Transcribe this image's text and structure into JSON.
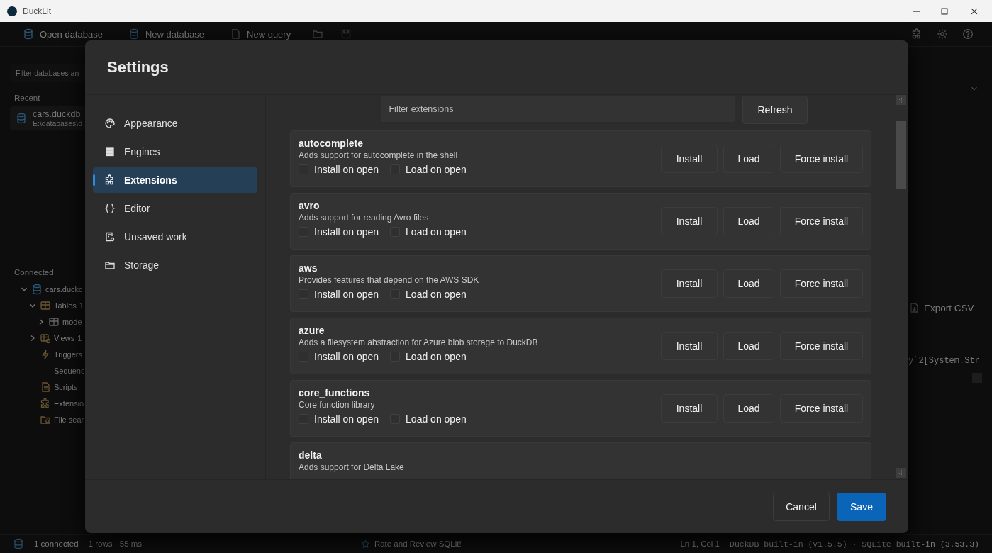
{
  "window": {
    "title": "DuckLit"
  },
  "toolbar": {
    "items": [
      "Open database",
      "New database",
      "New query"
    ]
  },
  "sidebar": {
    "filter_placeholder": "Filter databases an",
    "recent_label": "Recent",
    "recent": [
      {
        "name": "cars.duckdb",
        "path": "E:\\databases\\d"
      }
    ],
    "connected_label": "Connected",
    "tree": [
      {
        "label": "cars.duckc",
        "expanded": true,
        "children": [
          {
            "label": "Tables",
            "count": "1",
            "expanded": true,
            "children": [
              {
                "label": "mode",
                "expanded": false
              }
            ]
          },
          {
            "label": "Views",
            "count": "1",
            "expanded": false
          },
          {
            "label": "Triggers"
          },
          {
            "label": "Sequenc"
          },
          {
            "label": "Scripts"
          },
          {
            "label": "Extensio"
          },
          {
            "label": "File sear"
          }
        ]
      }
    ]
  },
  "results": {
    "export_label": "Export CSV",
    "cell_text": "y`2[System.Str"
  },
  "settings": {
    "title": "Settings",
    "nav": [
      {
        "label": "Appearance",
        "selected": false
      },
      {
        "label": "Engines",
        "selected": false
      },
      {
        "label": "Extensions",
        "selected": true
      },
      {
        "label": "Editor",
        "selected": false
      },
      {
        "label": "Unsaved work",
        "selected": false
      },
      {
        "label": "Storage",
        "selected": false
      }
    ],
    "filter_placeholder": "Filter extensions",
    "refresh_label": "Refresh",
    "extensions": [
      {
        "name": "autocomplete",
        "description": "Adds support for autocomplete in the shell",
        "options": [
          {
            "label": "Install on open",
            "checked": false
          },
          {
            "label": "Load on open",
            "checked": false
          }
        ],
        "buttons": [
          "Install",
          "Load",
          "Force install"
        ]
      },
      {
        "name": "avro",
        "description": "Adds support for reading Avro files",
        "options": [
          {
            "label": "Install on open",
            "checked": false
          },
          {
            "label": "Load on open",
            "checked": false
          }
        ],
        "buttons": [
          "Install",
          "Load",
          "Force install"
        ]
      },
      {
        "name": "aws",
        "description": "Provides features that depend on the AWS SDK",
        "options": [
          {
            "label": "Install on open",
            "checked": false
          },
          {
            "label": "Load on open",
            "checked": false
          }
        ],
        "buttons": [
          "Install",
          "Load",
          "Force install"
        ]
      },
      {
        "name": "azure",
        "description": "Adds a filesystem abstraction for Azure blob storage to DuckDB",
        "options": [
          {
            "label": "Install on open",
            "checked": false
          },
          {
            "label": "Load on open",
            "checked": false
          }
        ],
        "buttons": [
          "Install",
          "Load",
          "Force install"
        ]
      },
      {
        "name": "core_functions",
        "description": "Core function library",
        "options": [
          {
            "label": "Install on open",
            "checked": false
          },
          {
            "label": "Load on open",
            "checked": false
          }
        ],
        "buttons": [
          "Install",
          "Load",
          "Force install"
        ]
      },
      {
        "name": "delta",
        "description": "Adds support for Delta Lake"
      }
    ],
    "cancel_label": "Cancel",
    "save_label": "Save"
  },
  "status_bar": {
    "connections": "1 connected",
    "rows": "1 rows · 55 ms",
    "rate": "Rate and Review SQLit!",
    "position": "Ln 1, Col 1",
    "engines": "DuckDB built-in (v1.5.5) · SQLite built-in (3.53.3)"
  }
}
